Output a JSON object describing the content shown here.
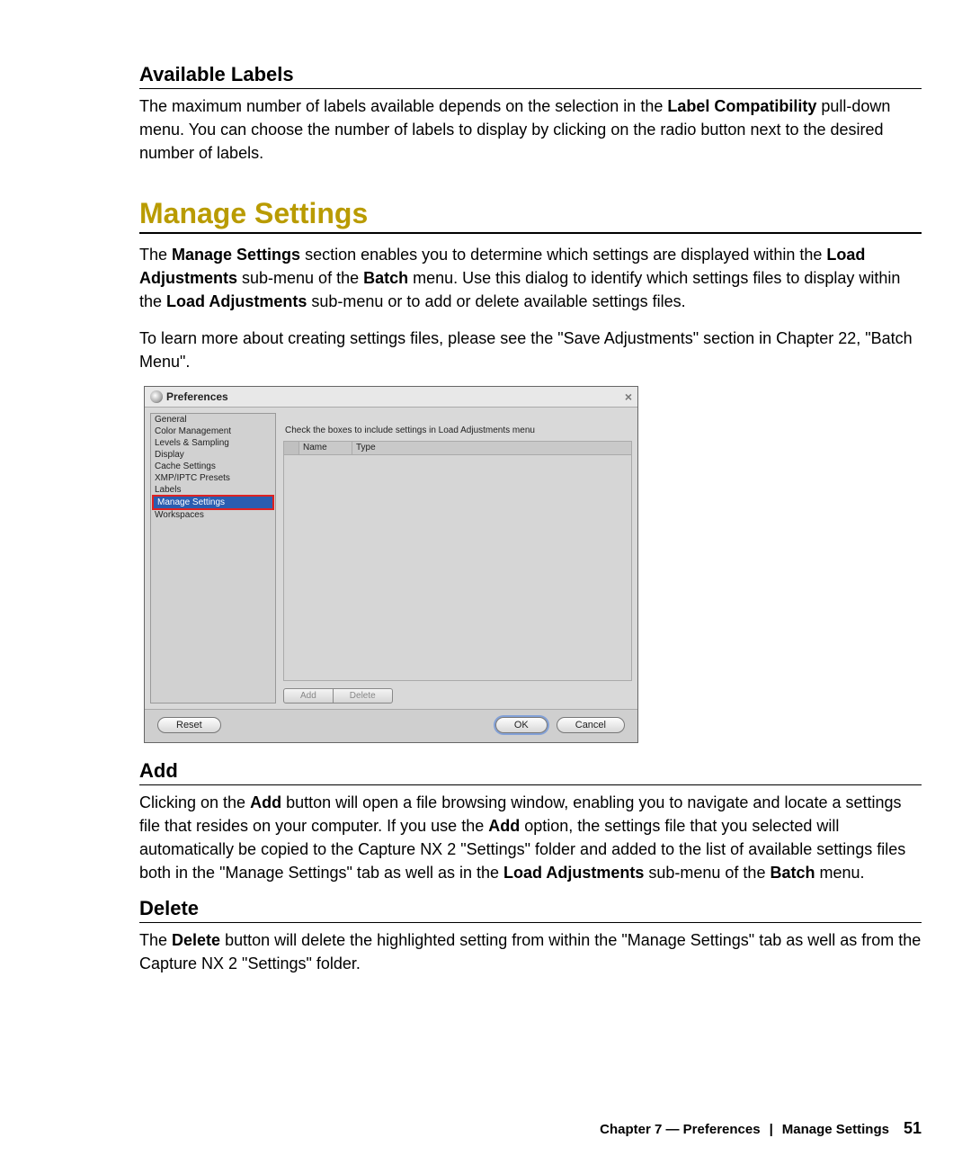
{
  "sections": {
    "available_labels": {
      "heading": "Available Labels",
      "para_parts": {
        "p1a": "The maximum number of labels available depends on the selection in the ",
        "p1b": "Label Compatibility",
        "p1c": " pull-down menu. You can choose the number of labels to display by clicking on the radio button next to the desired number of labels."
      }
    },
    "manage_settings": {
      "heading": "Manage Settings",
      "para1": {
        "a": "The ",
        "b": "Manage Settings",
        "c": " section enables you to determine which settings are displayed within the ",
        "d": "Load Adjustments",
        "e": " sub-menu of the ",
        "f": "Batch",
        "g": " menu. Use this dialog to identify which settings files to display within the ",
        "h": "Load Adjustments",
        "i": " sub-menu or to add or delete available settings files."
      },
      "para2": "To learn more about creating settings files, please see the \"Save Adjustments\" section in Chapter 22, \"Batch Menu\"."
    },
    "add": {
      "heading": "Add",
      "para": {
        "a": "Clicking on the ",
        "b": "Add",
        "c": " button will open a file browsing window, enabling you to navigate and locate a settings file that resides on your computer. If you use the ",
        "d": "Add",
        "e": " option, the settings file that you selected will automatically be copied to the Capture NX 2 \"Settings\" folder and added to the list of available settings files both in the \"Manage Settings\" tab as well as in the ",
        "f": "Load Adjustments",
        "g": " sub-menu of the ",
        "h": "Batch",
        "i": " menu."
      }
    },
    "delete": {
      "heading": "Delete",
      "para": {
        "a": "The ",
        "b": "Delete",
        "c": " button will delete the highlighted setting from within the \"Manage Settings\" tab as well as from the Capture NX 2 \"Settings\" folder."
      }
    }
  },
  "dialog": {
    "title": "Preferences",
    "sidebar_items": [
      "General",
      "Color Management",
      "Levels & Sampling",
      "Display",
      "Cache Settings",
      "XMP/IPTC Presets",
      "Labels",
      "Manage Settings",
      "Workspaces"
    ],
    "instruction": "Check the boxes to include settings in Load Adjustments menu",
    "columns": {
      "name": "Name",
      "type": "Type"
    },
    "buttons": {
      "add": "Add",
      "delete": "Delete",
      "reset": "Reset",
      "ok": "OK",
      "cancel": "Cancel"
    }
  },
  "footer": {
    "chapter": "Chapter 7 — Preferences",
    "section": "Manage Settings",
    "page": "51"
  }
}
